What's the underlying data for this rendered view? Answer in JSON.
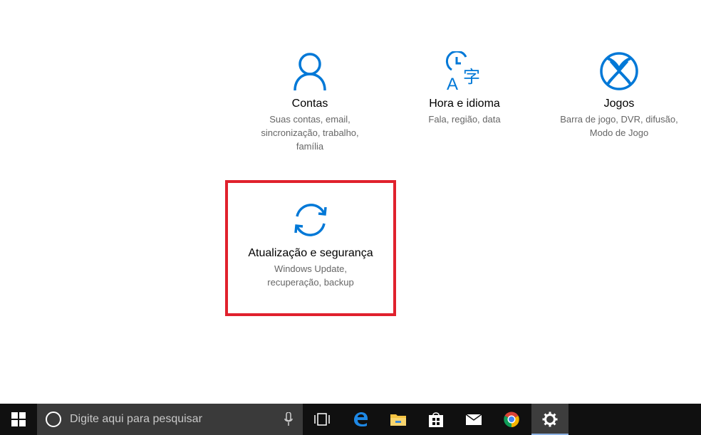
{
  "tiles": [
    {
      "id": "contas",
      "title": "Contas",
      "desc": "Suas contas, email,\nsincronização, trabalho,\nfamília",
      "icon": "person-icon"
    },
    {
      "id": "hora",
      "title": "Hora e idioma",
      "desc": "Fala, região, data",
      "icon": "time-language-icon"
    },
    {
      "id": "jogos",
      "title": "Jogos",
      "desc": "Barra de jogo, DVR, difusão,\nModo de Jogo",
      "icon": "xbox-icon"
    },
    {
      "id": "update",
      "title": "Atualização e segurança",
      "desc": "Windows Update,\nrecuperação, backup",
      "icon": "sync-icon"
    }
  ],
  "colors": {
    "accent": "#0078d7",
    "highlight": "#e0212d",
    "taskbar": "#101010"
  },
  "taskbar": {
    "search_placeholder": "Digite aqui para pesquisar",
    "icons": [
      "windows-start-icon",
      "cortana-icon",
      "microphone-icon",
      "task-view-icon",
      "edge-icon",
      "file-explorer-icon",
      "store-icon",
      "mail-icon",
      "chrome-icon",
      "settings-gear-icon"
    ]
  }
}
